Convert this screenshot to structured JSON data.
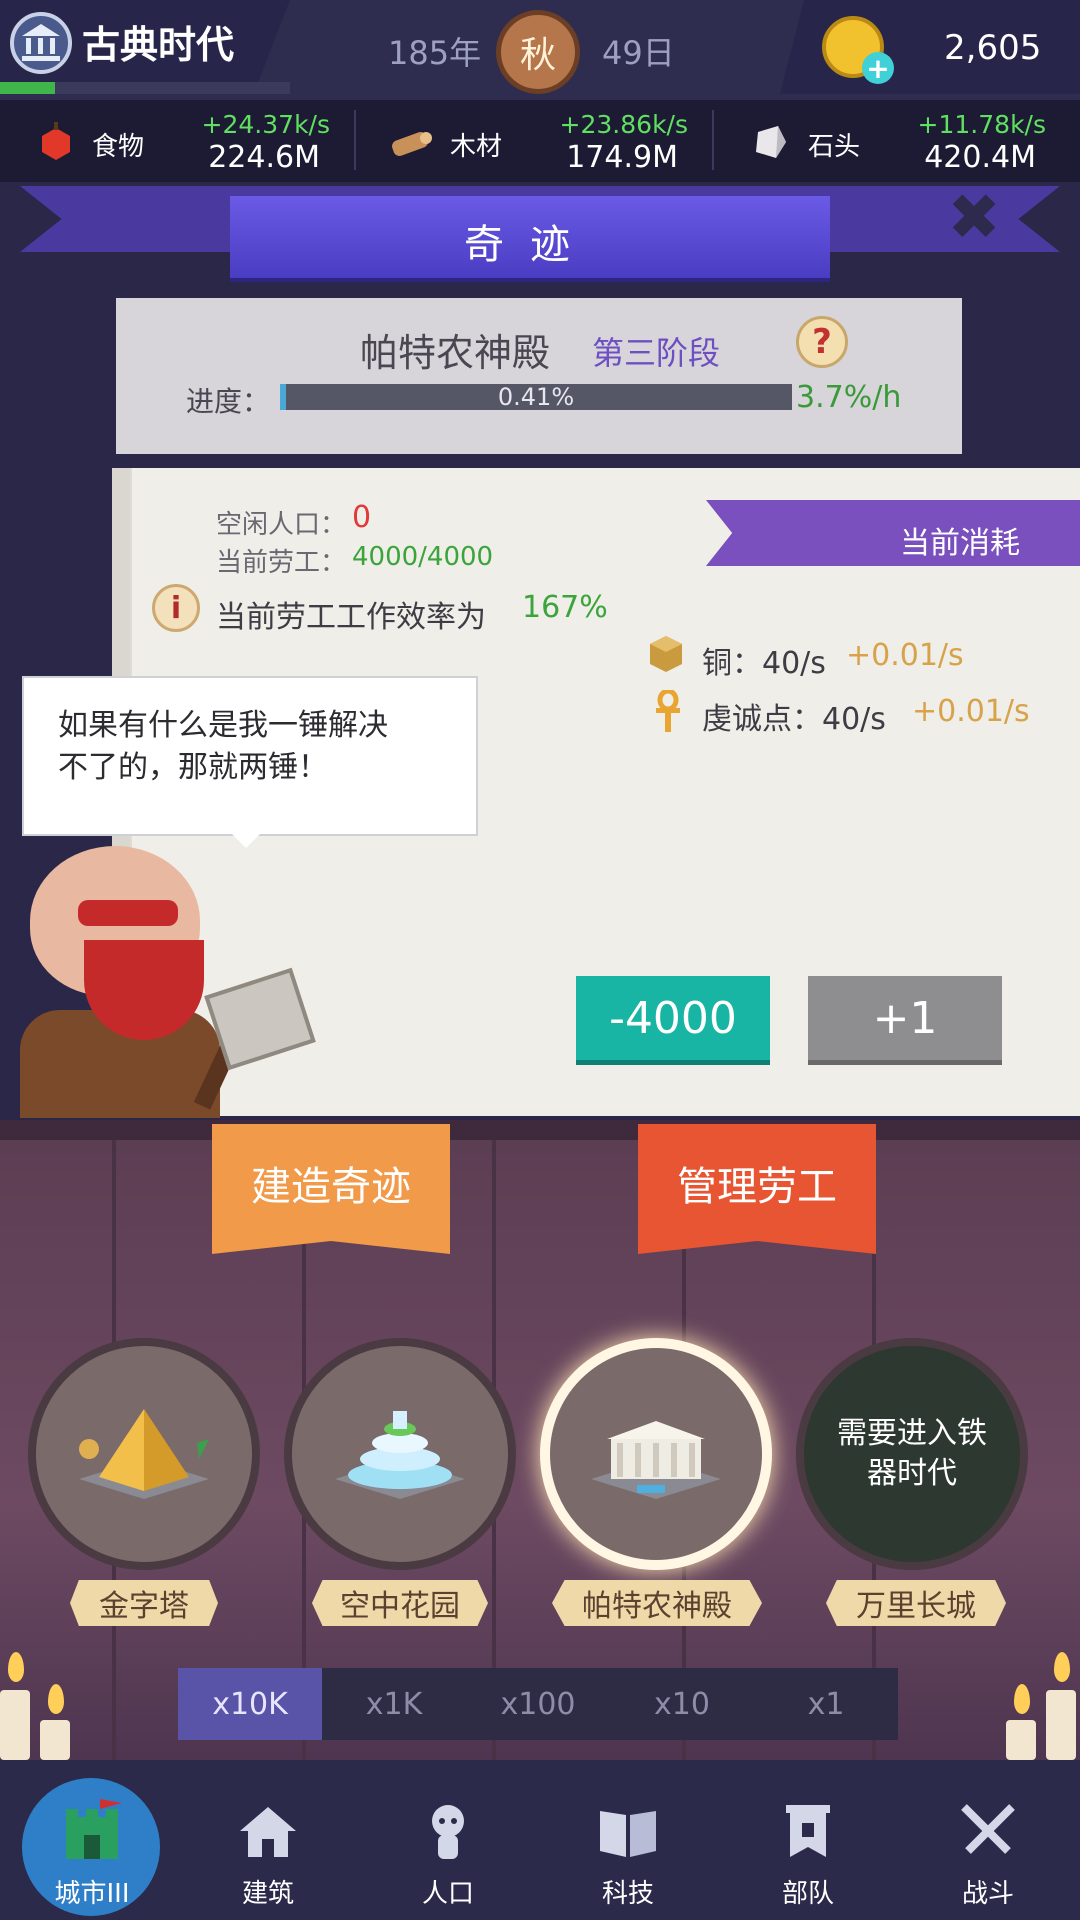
{
  "header": {
    "era": "古典时代",
    "era_progress": 0.19,
    "year": "185年",
    "season": "秋",
    "day": "49日",
    "gold": "2,605"
  },
  "resources": [
    {
      "name": "食物",
      "rate": "+24.37k/s",
      "total": "224.6M",
      "icon": "food-icon"
    },
    {
      "name": "木材",
      "rate": "+23.86k/s",
      "total": "174.9M",
      "icon": "wood-icon"
    },
    {
      "name": "石头",
      "rate": "+11.78k/s",
      "total": "420.4M",
      "icon": "stone-icon"
    }
  ],
  "panel": {
    "title": "奇迹",
    "wonder_name": "帕特农神殿",
    "stage": "第三阶段",
    "progress_label": "进度：",
    "progress_text": "0.41%",
    "progress_value": 0.0041,
    "progress_rate": "3.7%/h",
    "idle_label": "空闲人口：",
    "idle_value": "0",
    "labor_label": "当前劳工：",
    "labor_value": "4000/4000",
    "efficiency_label": "当前劳工工作效率为",
    "efficiency_value": "167%",
    "consume_title": "当前消耗",
    "consumption": [
      {
        "label": "铜：40/s",
        "extra": "+0.01/s",
        "icon": "copper-icon"
      },
      {
        "label": "虔诚点：40/s",
        "extra": "+0.01/s",
        "icon": "ankh-icon"
      }
    ],
    "quote_line1": "如果有什么是我一锤解决",
    "quote_line2": "不了的，那就两锤！",
    "minus_btn": "-4000",
    "plus_btn": "+1"
  },
  "actions": {
    "build": "建造奇迹",
    "manage": "管理劳工"
  },
  "wonders": [
    {
      "name": "金字塔",
      "icon": "pyramid-icon",
      "state": "normal"
    },
    {
      "name": "空中花园",
      "icon": "hanging-garden-icon",
      "state": "normal"
    },
    {
      "name": "帕特农神殿",
      "icon": "parthenon-icon",
      "state": "selected"
    },
    {
      "name": "万里长城",
      "icon": "great-wall-icon",
      "state": "locked",
      "locked_text": "需要进入铁器时代"
    }
  ],
  "multipliers": [
    "x10K",
    "x1K",
    "x100",
    "x10",
    "x1"
  ],
  "active_multiplier": "x10K",
  "nav": [
    {
      "label": "城市III",
      "icon": "castle-icon",
      "active": true
    },
    {
      "label": "建筑",
      "icon": "house-icon"
    },
    {
      "label": "人口",
      "icon": "person-icon"
    },
    {
      "label": "科技",
      "icon": "book-icon"
    },
    {
      "label": "部队",
      "icon": "banner-icon"
    },
    {
      "label": "战斗",
      "icon": "crossed-swords-icon"
    }
  ],
  "colors": {
    "positive": "#3ba43b",
    "negative": "#e23a3a",
    "accent_purple": "#7a4fbe",
    "teal_button": "#19b5a4"
  }
}
